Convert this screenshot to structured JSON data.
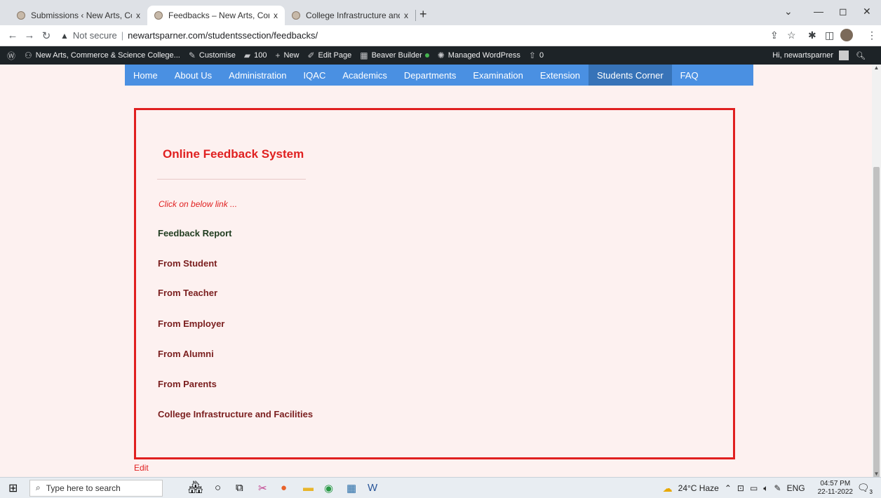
{
  "browser": {
    "tabs": [
      {
        "title": "Submissions ‹ New Arts, Comme",
        "active": false
      },
      {
        "title": "Feedbacks – New Arts, Commerc",
        "active": true
      },
      {
        "title": "College Infrastructure and Facilit",
        "active": false
      }
    ],
    "close_glyph": "x",
    "new_tab_glyph": "+",
    "address": {
      "security_label": "Not secure",
      "url": "newartsparner.com/studentssection/feedbacks/"
    }
  },
  "admin_bar": {
    "site_name": "New Arts, Commerce & Science College...",
    "customise": "Customise",
    "comments_count": "100",
    "new_label": "New",
    "edit_page": "Edit Page",
    "beaver_builder": "Beaver Builder",
    "managed_wp": "Managed WordPress",
    "updates_count": "0",
    "greeting": "Hi, newartsparner"
  },
  "site_nav": {
    "items": [
      "Home",
      "About Us",
      "Administration",
      "IQAC",
      "Academics",
      "Departments",
      "Examination",
      "Extension",
      "Students Corner",
      "FAQ"
    ],
    "active_item": "Students Corner"
  },
  "content": {
    "heading": "Online Feedback System",
    "intro": "Click on below link ...",
    "links": [
      "Feedback Report",
      "From Student",
      "From Teacher",
      "From Employer",
      "From Alumni",
      "From Parents",
      "College Infrastructure and Facilities"
    ],
    "edit_link": "Edit"
  },
  "taskbar": {
    "search_placeholder": "Type here to search",
    "weather": "24°C Haze",
    "language": "ENG",
    "time": "04:57 PM",
    "date": "22-11-2022",
    "notification_count": "3"
  },
  "colors": {
    "accent_red": "#e02020",
    "nav_blue": "#4a90e2",
    "nav_active": "#3773b8",
    "page_bg": "#fdf1f0",
    "link_maroon": "#7a1e1e"
  }
}
